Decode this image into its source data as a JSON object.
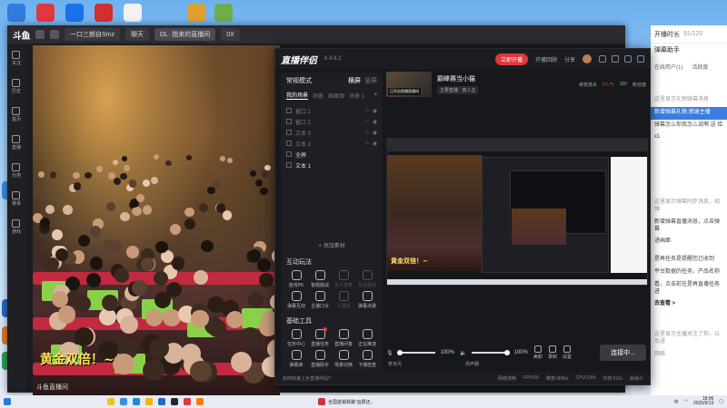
{
  "browser": {
    "logo": "斗鱼",
    "tabs": [
      "一口三朗自Smz",
      "聊天",
      "DL· 指来的直播间",
      "0X"
    ],
    "sidebar": [
      "关注",
      "历史",
      "首页",
      "直播",
      "分类",
      "赛事",
      "游戏"
    ]
  },
  "video": {
    "caption": "黄金双倍！~",
    "subtitle": "斗鱼直播间"
  },
  "chat": {
    "header": "开播时长",
    "count": "91/120",
    "title": "弹幕助手",
    "tabs": [
      "在线用户(1)",
      "活跃度"
    ],
    "lines": [
      "这里显示礼物弹幕消息",
      "新增弹幕礼物 感谢主播",
      "弹幕怎么你我怎么说啊 送 给",
      "x1",
      "这里显示弹幕同步消息，如弹",
      "新增弹幕直播消息，点击弹幕",
      "进画面",
      "是再任务是提醒您已收到",
      "平台数据的任务，产品名称",
      "看，点击前往是再直播任务进",
      "去查看 >",
      "这里显示主播关注了你，以及进",
      "网络"
    ]
  },
  "app": {
    "title": "直播伴侣",
    "version": "6.4.9.2",
    "live_btn": "立即开播",
    "title_actions": [
      "开播回顾",
      "分享"
    ],
    "mode": "常规模式",
    "mode_options": [
      "横屏",
      "竖屏"
    ],
    "scene_tabs": [
      "我的场景",
      "场景",
      "画面源",
      "场景 1"
    ],
    "sources": [
      {
        "name": "窗口 1",
        "on": false
      },
      {
        "name": "窗口 2",
        "on": false
      },
      {
        "name": "文本 3",
        "on": false
      },
      {
        "name": "文本 2",
        "on": false
      },
      {
        "name": "全屏",
        "on": true
      },
      {
        "name": "文本 1",
        "on": true
      }
    ],
    "add_source": "+ 添加素材",
    "interact_title": "互动玩法",
    "interact_tools": [
      {
        "label": "连线PK",
        "dim": false
      },
      {
        "label": "答题挑战",
        "dim": false
      },
      {
        "label": "多人连麦",
        "dim": true
      },
      {
        "label": "互动游戏",
        "dim": true
      },
      {
        "label": "弹幕互动",
        "dim": false
      },
      {
        "label": "主播口令",
        "dim": false
      },
      {
        "label": "小游戏",
        "dim": true
      },
      {
        "label": "弹幕点歌",
        "dim": false
      }
    ],
    "basic_title": "基础工具",
    "basic_tools": [
      {
        "label": "任务中心",
        "dim": false,
        "badge": false
      },
      {
        "label": "直播任务",
        "dim": false,
        "badge": true
      },
      {
        "label": "直播问答",
        "dim": false,
        "badge": false
      },
      {
        "label": "正在推流",
        "dim": false,
        "badge": false
      },
      {
        "label": "弹幕库",
        "dim": false,
        "badge": false
      },
      {
        "label": "直播助手",
        "dim": false,
        "badge": false
      },
      {
        "label": "场景切换",
        "dim": false,
        "badge": false
      },
      {
        "label": "下播检查",
        "dim": false,
        "badge": false
      }
    ],
    "more_fn": "••• 更多功能",
    "room": {
      "name": "巅峰赛当小猫",
      "tag": "主要直播 · 真人主",
      "cover_label": "已开启首播直播间",
      "stats": [
        "考核流水",
        "人气值",
        "100",
        "粉丝值"
      ],
      "hot": "0人气"
    },
    "preview_caption": "黄金双倍！~",
    "bottom": {
      "mic_label": "麦克风",
      "mic_pct": "100%",
      "spk_label": "扬声器",
      "spk_pct": "100%",
      "controls": [
        "美颜",
        "录制",
        "设置"
      ],
      "go_live": "连接中..."
    },
    "status": {
      "left": "如何快速上手直播伴侣?",
      "items": [
        "网络流畅",
        "FPS:60",
        "带宽:0KB/s",
        "CPU:19%",
        "内存:51%",
        "丢帧:0"
      ]
    }
  },
  "taskbar": {
    "notif": "全国首销铁路“运费还..",
    "time": "18:06",
    "date": "2025/9/13",
    "lang": "中"
  }
}
